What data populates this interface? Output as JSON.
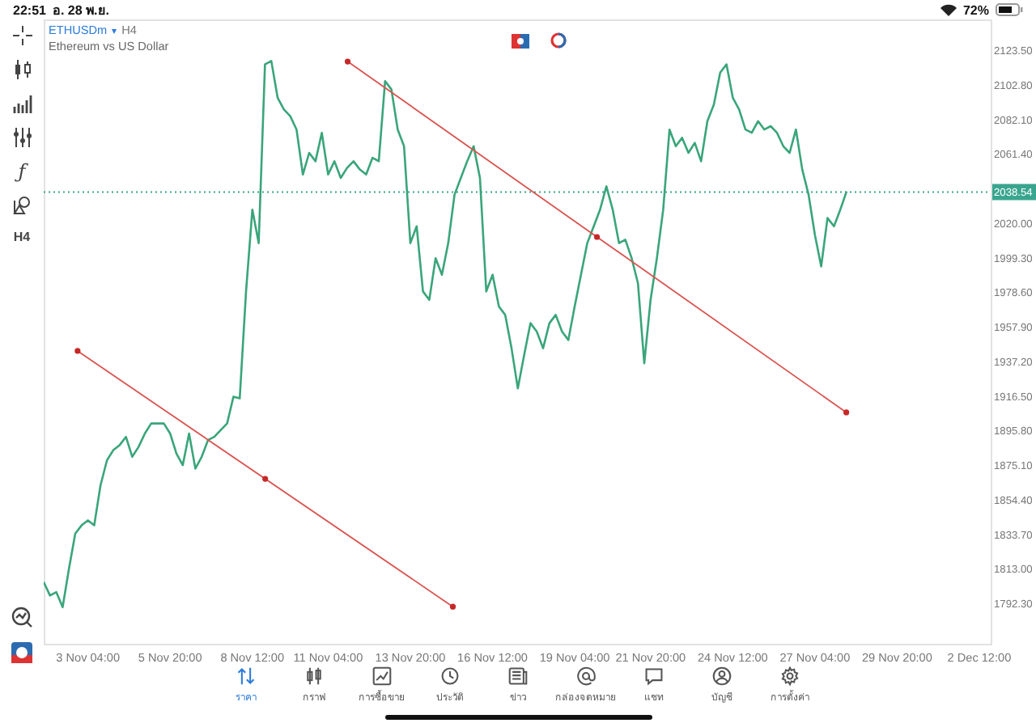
{
  "status_bar": {
    "time": "22:51",
    "date": "อ. 28 พ.ย.",
    "battery": "72%"
  },
  "symbol": {
    "caret": "▾",
    "timeframe": "H4",
    "description": "Ethereum vs US Dollar"
  },
  "left_toolbar": {
    "function_label": "ƒ",
    "timeframe": "H4"
  },
  "chart": {
    "current_price": "2038.54",
    "trend_lines": [
      {
        "kind": "trendline"
      },
      {
        "kind": "trendline"
      }
    ],
    "chart_data": {
      "type": "line",
      "ylim": [
        1768.1,
        2141.9
      ],
      "yticks": [
        {
          "value": 1792.3,
          "label": "1792.30"
        },
        {
          "value": 1813.0,
          "label": "1813.00"
        },
        {
          "value": 1833.7,
          "label": "1833.70"
        },
        {
          "value": 1854.4,
          "label": "1854.40"
        },
        {
          "value": 1875.1,
          "label": "1875.10"
        },
        {
          "value": 1895.8,
          "label": "1895.80"
        },
        {
          "value": 1916.5,
          "label": "1916.50"
        },
        {
          "value": 1937.2,
          "label": "1937.20"
        },
        {
          "value": 1957.9,
          "label": "1957.90"
        },
        {
          "value": 1978.6,
          "label": "1978.60"
        },
        {
          "value": 1999.3,
          "label": "1999.30"
        },
        {
          "value": 2020.0,
          "label": "2020.00"
        },
        {
          "value": 2061.4,
          "label": "2061.40"
        },
        {
          "value": 2082.1,
          "label": "2082.10"
        },
        {
          "value": 2102.8,
          "label": "2102.80"
        },
        {
          "value": 2123.5,
          "label": "2123.50"
        }
      ],
      "categories": [
        null,
        null,
        null,
        null,
        null,
        null,
        null,
        "3 Nov 04:00",
        null,
        null,
        null,
        null,
        null,
        null,
        null,
        null,
        null,
        null,
        null,
        null,
        "5 Nov 20:00",
        null,
        null,
        null,
        null,
        null,
        null,
        null,
        null,
        null,
        null,
        null,
        null,
        "8 Nov 12:00",
        null,
        null,
        null,
        null,
        null,
        null,
        null,
        null,
        null,
        null,
        null,
        "11 Nov 04:00",
        null,
        null,
        null,
        null,
        null,
        null,
        null,
        null,
        null,
        null,
        null,
        null,
        "13 Nov 20:00",
        null,
        null,
        null,
        null,
        null,
        null,
        null,
        null,
        null,
        null,
        null,
        null,
        "16 Nov 12:00",
        null,
        null,
        null,
        null,
        null,
        null,
        null,
        null,
        null,
        null,
        null,
        null,
        "19 Nov 04:00",
        null,
        null,
        null,
        null,
        null,
        null,
        null,
        null,
        null,
        null,
        null,
        "21 Nov 20:00",
        null,
        null,
        null,
        null,
        null,
        null,
        null,
        null,
        null,
        null,
        null,
        null,
        "24 Nov 12:00",
        null,
        null,
        null,
        null,
        null,
        null,
        null,
        null,
        null,
        null,
        null,
        null,
        "27 Nov 04:00",
        null,
        null,
        null,
        null,
        null,
        null,
        null,
        null,
        null,
        null,
        null,
        null,
        "29 Nov 20:00",
        null,
        null,
        null,
        null,
        null,
        null,
        null,
        null,
        null,
        null,
        null,
        null,
        "2 Dec 12:00",
        null
      ],
      "series": [
        {
          "name": "ETHUSDm",
          "color": "#3aa57a",
          "values": [
            1805,
            1797,
            1799,
            1790,
            1813,
            1834,
            1839,
            1842,
            1839,
            1863,
            1878,
            1884,
            1887,
            1892,
            1880,
            1886,
            1894,
            1900,
            1900,
            1900,
            1894,
            1882,
            1875,
            1894,
            1873,
            1880,
            1890,
            1892,
            1896,
            1900,
            1916,
            1915,
            1979,
            2028,
            2008,
            2115,
            2117,
            2095,
            2088,
            2084,
            2076,
            2049,
            2062,
            2057,
            2074,
            2049,
            2057,
            2047,
            2053,
            2057,
            2052,
            2049,
            2059,
            2057,
            2105,
            2100,
            2076,
            2066,
            2008,
            2018,
            1979,
            1974,
            1999,
            1989,
            2008,
            2037,
            2047,
            2057,
            2066,
            2047,
            1979,
            1989,
            1970,
            1965,
            1945,
            1921,
            1941,
            1960,
            1955,
            1945,
            1960,
            1965,
            1955,
            1950,
            1970,
            1989,
            2008,
            2018,
            2028,
            2042,
            2028,
            2008,
            2010,
            1999,
            1984,
            1936,
            1974,
            1999,
            2028,
            2076,
            2066,
            2071,
            2062,
            2068,
            2057,
            2081,
            2091,
            2110,
            2115,
            2095,
            2088,
            2076,
            2074,
            2081,
            2076,
            2078,
            2074,
            2066,
            2062,
            2076,
            2052,
            2037,
            2013,
            1994,
            2023,
            2018,
            2028,
            2039,
            null,
            null,
            null,
            null,
            null,
            null,
            null,
            null,
            null,
            null,
            null,
            null,
            null,
            null,
            null,
            null,
            null,
            null,
            null,
            null,
            null,
            null
          ]
        }
      ]
    }
  },
  "bottom_nav": [
    {
      "label": "ราคา",
      "selected": true
    },
    {
      "label": "กราฟ",
      "selected": false
    },
    {
      "label": "การซื้อขาย",
      "selected": false
    },
    {
      "label": "ประวัติ",
      "selected": false
    },
    {
      "label": "ข่าว",
      "selected": false
    },
    {
      "label": "กล่องจดหมาย",
      "selected": false
    },
    {
      "label": "แชท",
      "selected": false
    },
    {
      "label": "บัญชี",
      "selected": false
    },
    {
      "label": "การตั้งค่า",
      "selected": false
    }
  ]
}
